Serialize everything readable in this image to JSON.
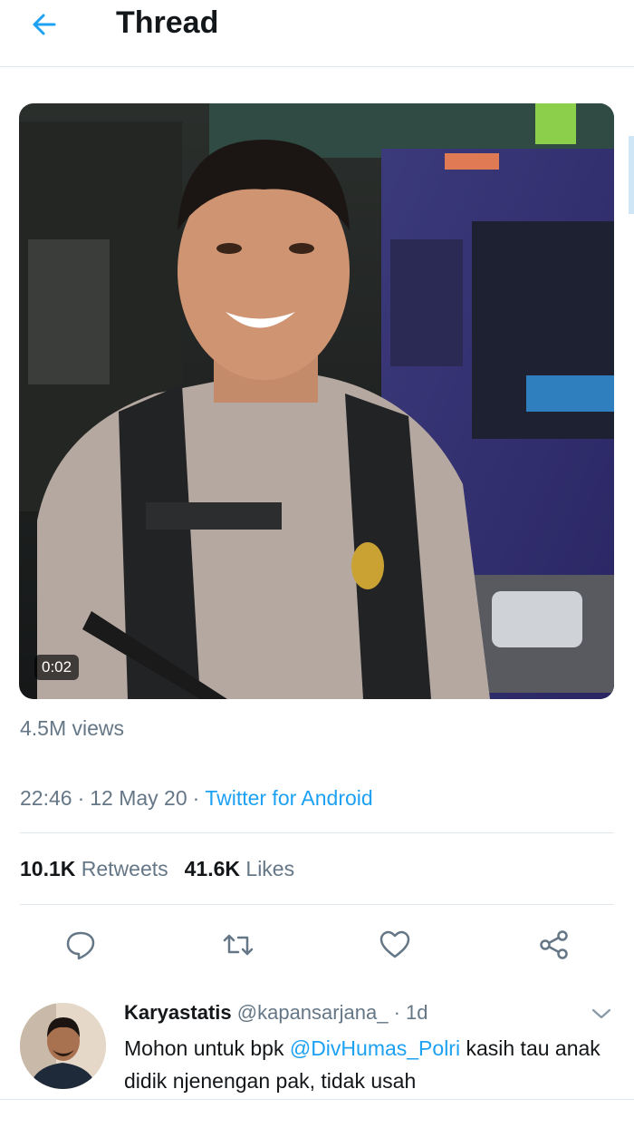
{
  "header": {
    "title": "Thread"
  },
  "video": {
    "duration": "0:02"
  },
  "tweet": {
    "views": "4.5M views",
    "time": "22:46",
    "date": "12 May 20",
    "separator": "·",
    "source": "Twitter for Android",
    "retweets_count": "10.1K",
    "retweets_label": "Retweets",
    "likes_count": "41.6K",
    "likes_label": "Likes"
  },
  "actions": [
    "reply-icon",
    "retweet-icon",
    "like-icon",
    "share-icon"
  ],
  "reply": {
    "name": "Karyastatis",
    "handle": "@kapansarjana_",
    "dot": "·",
    "age": "1d",
    "text_before": "Mohon untuk bpk ",
    "mention": "@DivHumas_Polri",
    "text_after": " kasih tau anak didik njenengan pak, tidak usah"
  },
  "colors": {
    "accent": "#1da1f2",
    "secondary_text": "#657786",
    "divider": "#e1e8ed"
  }
}
